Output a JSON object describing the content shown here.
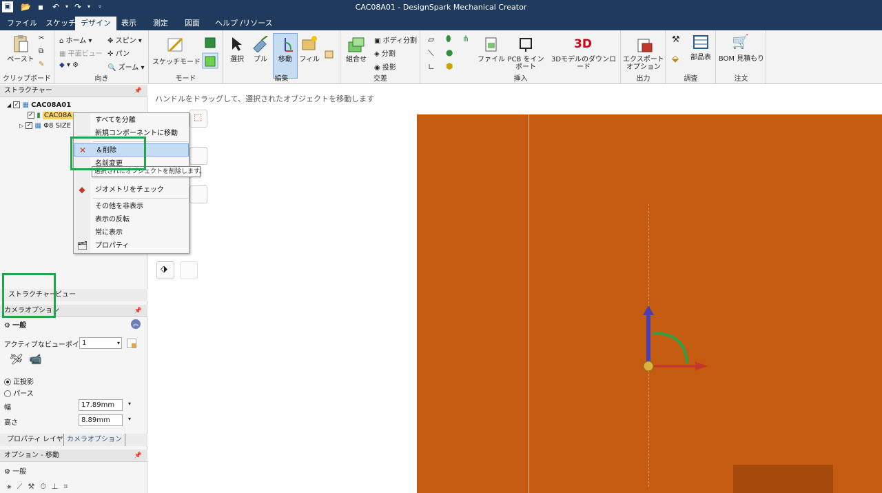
{
  "window": {
    "title": "CAC08A01 - DesignSpark Mechanical Creator"
  },
  "menu_tabs": [
    "ファイル",
    "スケッチ",
    "デザイン",
    "表示",
    "測定",
    "図面",
    "ヘルプ /リソース"
  ],
  "active_tab": "デザイン",
  "ribbon": {
    "clipboard": {
      "paste": "ペースト",
      "label": "クリップボード"
    },
    "orient": {
      "home": "ホーム",
      "plane_view": "平面ビュー",
      "spin": "スピン",
      "pan": "パン",
      "zoom": "ズーム",
      "label": "向き"
    },
    "mode": {
      "sketch_mode": "スケッチモード",
      "label": "モード"
    },
    "edit": {
      "select": "選択",
      "pull": "プル",
      "move": "移動",
      "fill": "フィル",
      "label": "編集"
    },
    "intersect": {
      "combine": "組合せ",
      "split_body": "ボディ分割",
      "split": "分割",
      "project": "投影",
      "label": "交差"
    },
    "insert": {
      "file": "ファイル",
      "pcb": "PCB をインポート",
      "model_3d": "3Dモデルのダウンロード",
      "label": "挿入"
    },
    "output": {
      "export": "エクスポートオプション",
      "label": "出力"
    },
    "investigate": {
      "bom_table": "部品表",
      "label": "調査"
    },
    "order": {
      "bom_quote": "BOM 見積もり",
      "label": "注文"
    },
    "colors": {
      "model_3d": "#d0021b",
      "accent": "#1f3a5c"
    }
  },
  "structure": {
    "header": "ストラクチャー",
    "root": "CAC08A01",
    "items": [
      "CAC08A",
      "Φ8 SIZE"
    ]
  },
  "context_menu": {
    "items": [
      "すべてを分離",
      "新規コンポーネントに移動",
      "＆削除",
      "名前変更",
      "ジオメトリをチェック",
      "その他を非表示",
      "表示の反転",
      "常に表示",
      "プロパティ"
    ],
    "tooltip": "選択されたオブジェクトを削除します。",
    "selected_index": 2
  },
  "left_tabs": {
    "structure": "ストラクチャー",
    "view": "ビュー"
  },
  "camera": {
    "header": "カメラオプション",
    "section": "一般",
    "active_viewpoint_label": "アクティブなビューポイント",
    "active_viewpoint_value": "1",
    "ortho": "正投影",
    "perspective": "パース",
    "width_label": "幅",
    "width_value": "17.89mm",
    "height_label": "高さ",
    "height_value": "8.89mm"
  },
  "bottom_tabs": [
    "プロパティ",
    "レイヤ",
    "カメラオプション"
  ],
  "options_move": {
    "header": "オプション - 移動",
    "section": "一般"
  },
  "canvas": {
    "hint": "ハンドルをドラッグして、選択されたオブジェクトを移動します",
    "part_color": "#c55a11"
  }
}
